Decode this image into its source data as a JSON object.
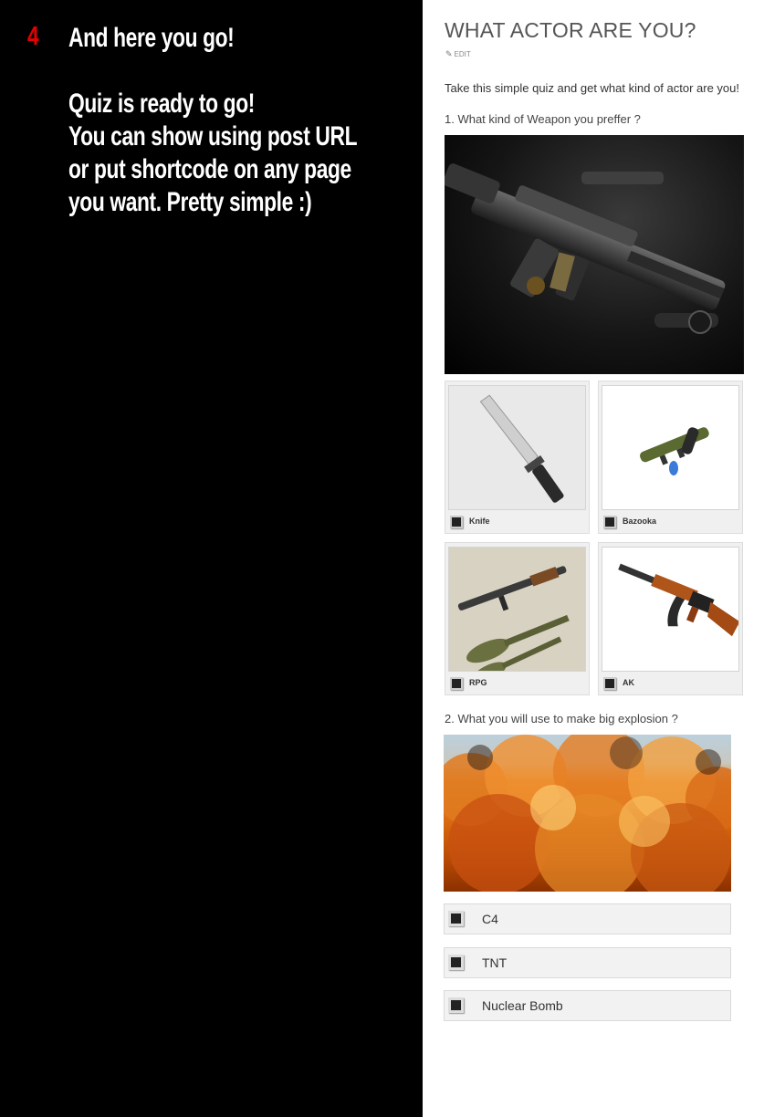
{
  "left": {
    "step_number": "4",
    "heading": "And here you go!",
    "paragraph_lines": [
      "Quiz is ready to go!",
      "You can show using post URL",
      "or put shortcode on any page",
      "you want. Pretty simple :)"
    ]
  },
  "quiz": {
    "title": "WHAT ACTOR ARE YOU?",
    "edit_label": "EDIT",
    "intro": "Take this simple quiz and get what kind of actor are you!",
    "questions": [
      {
        "text": "1. What kind of Weapon you preffer ?",
        "answers": [
          {
            "label": "Knife"
          },
          {
            "label": "Bazooka"
          },
          {
            "label": "RPG"
          },
          {
            "label": "AK"
          }
        ]
      },
      {
        "text": "2. What you will use to make big explosion ?",
        "answers": [
          {
            "label": "C4"
          },
          {
            "label": "TNT"
          },
          {
            "label": "Nuclear Bomb"
          }
        ]
      }
    ]
  },
  "colors": {
    "step_number": "#e60000",
    "left_background": "#000000",
    "left_text": "#ffffff",
    "title": "#555555"
  },
  "icons": {
    "edit": "pencil-icon"
  }
}
